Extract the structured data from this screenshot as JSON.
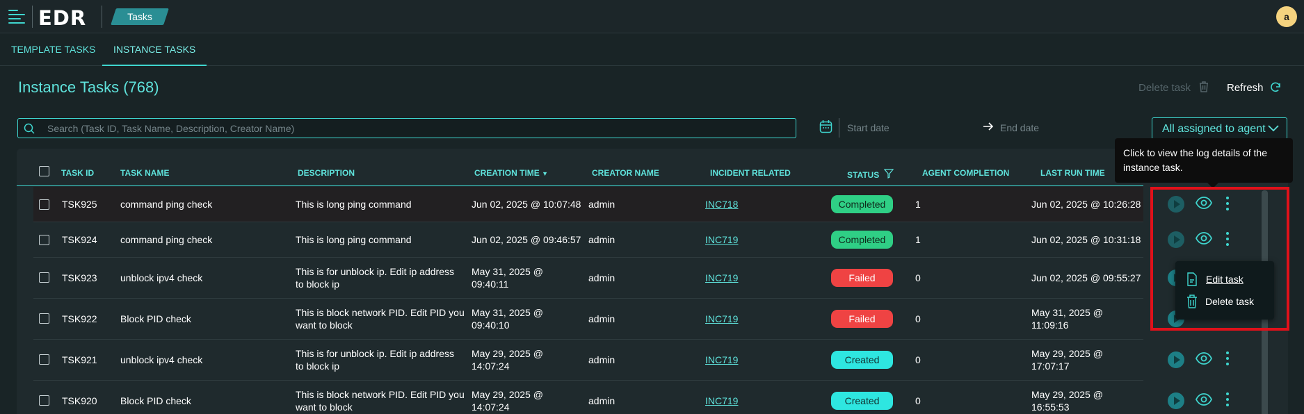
{
  "header": {
    "logo": "EDR",
    "breadcrumb": "Tasks",
    "avatar_initial": "a"
  },
  "tabs": [
    {
      "label": "TEMPLATE TASKS",
      "active": false
    },
    {
      "label": "INSTANCE TASKS",
      "active": true
    }
  ],
  "page": {
    "title": "Instance Tasks (768)",
    "delete_label": "Delete task",
    "refresh_label": "Refresh"
  },
  "filters": {
    "search_placeholder": "Search (Task ID, Task Name, Description, Creator Name)",
    "start_placeholder": "Start date",
    "end_placeholder": "End date",
    "agent_filter": "All assigned to agent"
  },
  "table": {
    "columns": [
      "TASK ID",
      "TASK NAME",
      "DESCRIPTION",
      "CREATION TIME",
      "CREATOR NAME",
      "INCIDENT RELATED",
      "STATUS",
      "AGENT COMPLETION",
      "LAST RUN TIME"
    ],
    "rows": [
      {
        "id": "TSK925",
        "name": "command ping check",
        "desc": [
          "This is long ping command"
        ],
        "created": [
          "Jun 02, 2025 @ 10:07:48"
        ],
        "creator": "admin",
        "incident": "INC718",
        "status": "Completed",
        "agents": "1",
        "last_run": [
          "Jun 02, 2025 @ 10:26:28"
        ]
      },
      {
        "id": "TSK924",
        "name": "command ping check",
        "desc": [
          "This is long ping command"
        ],
        "created": [
          "Jun 02, 2025 @ 09:46:57"
        ],
        "creator": "admin",
        "incident": "INC719",
        "status": "Completed",
        "agents": "1",
        "last_run": [
          "Jun 02, 2025 @ 10:31:18"
        ]
      },
      {
        "id": "TSK923",
        "name": "unblock ipv4 check",
        "desc": [
          "This is for unblock ip. Edit ip address",
          "to block ip"
        ],
        "created": [
          "May 31, 2025 @",
          "09:40:11"
        ],
        "creator": "admin",
        "incident": "INC719",
        "status": "Failed",
        "agents": "0",
        "last_run": [
          "Jun 02, 2025 @ 09:55:27"
        ]
      },
      {
        "id": "TSK922",
        "name": "Block PID check",
        "desc": [
          "This is block network PID. Edit PID you",
          "want to block"
        ],
        "created": [
          "May 31, 2025 @",
          "09:40:10"
        ],
        "creator": "admin",
        "incident": "INC719",
        "status": "Failed",
        "agents": "0",
        "last_run": [
          "May 31, 2025 @",
          "11:09:16"
        ]
      },
      {
        "id": "TSK921",
        "name": "unblock ipv4 check",
        "desc": [
          "This is for unblock ip. Edit ip address",
          "to block ip"
        ],
        "created": [
          "May 29, 2025 @",
          "14:07:24"
        ],
        "creator": "admin",
        "incident": "INC719",
        "status": "Created",
        "agents": "0",
        "last_run": [
          "May 29, 2025 @",
          "17:07:17"
        ]
      },
      {
        "id": "TSK920",
        "name": "Block PID check",
        "desc": [
          "This is block network PID. Edit PID you",
          "want to block"
        ],
        "created": [
          "May 29, 2025 @",
          "14:07:24"
        ],
        "creator": "admin",
        "incident": "INC719",
        "status": "Created",
        "agents": "0",
        "last_run": [
          "May 29, 2025 @",
          "16:55:53"
        ]
      }
    ]
  },
  "tooltip": "Click to view the log details of the instance task.",
  "context_menu": {
    "edit": "Edit task",
    "delete": "Delete task"
  },
  "colors": {
    "accent": "#3fd6cf",
    "completed": "#2fcf85",
    "failed": "#ef4343",
    "created": "#2ee6e0",
    "highlight": "#e0111a"
  }
}
